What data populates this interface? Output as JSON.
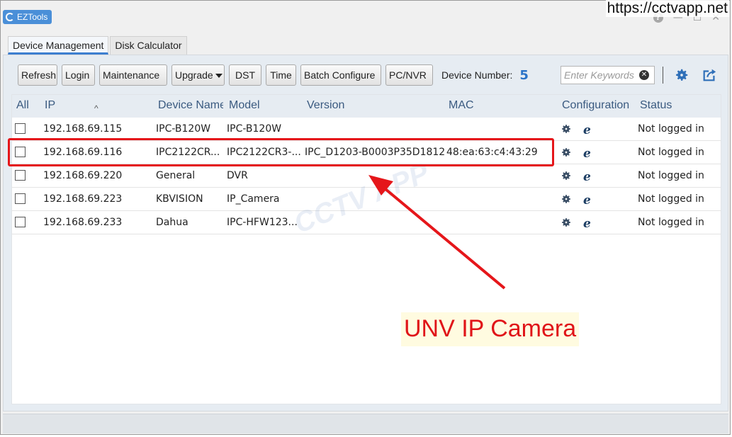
{
  "window": {
    "app_title": "EZTools",
    "help_glyph": "?",
    "minimize_glyph": "—",
    "maximize_glyph": "☐",
    "close_glyph": "✕"
  },
  "watermark_url": "https://cctvapp.net",
  "watermark_logo": "CCTV APP",
  "tabs": [
    "Device Management",
    "Disk Calculator"
  ],
  "active_tab": "Device Management",
  "toolbar": {
    "refresh": "Refresh",
    "login": "Login",
    "maintenance": "Maintenance",
    "upgrade": "Upgrade",
    "dst": "DST",
    "time": "Time",
    "batch_configure": "Batch Configure",
    "pc_nvr": "PC/NVR",
    "device_number_label": "Device Number:",
    "device_number_value": "5",
    "search_placeholder": "Enter Keywords"
  },
  "columns": {
    "all": "All",
    "ip": "IP",
    "device_name": "Device Name",
    "model": "Model",
    "version": "Version",
    "mac": "MAC",
    "configuration": "Configuration",
    "status": "Status"
  },
  "rows": [
    {
      "ip": "192.168.69.115",
      "device_name": "IPC-B120W",
      "model": "IPC-B120W",
      "version": "",
      "mac": "",
      "status": "Not logged in"
    },
    {
      "ip": "192.168.69.116",
      "device_name": "IPC2122CR...",
      "model": "IPC2122CR3-...",
      "version": "IPC_D1203-B0003P35D1812",
      "mac": "48:ea:63:c4:43:29",
      "status": "Not logged in"
    },
    {
      "ip": "192.168.69.220",
      "device_name": "General",
      "model": "DVR",
      "version": "",
      "mac": "",
      "status": "Not logged in"
    },
    {
      "ip": "192.168.69.223",
      "device_name": "KBVISION",
      "model": "IP_Camera",
      "version": "",
      "mac": "",
      "status": "Not logged in"
    },
    {
      "ip": "192.168.69.233",
      "device_name": "Dahua",
      "model": "IPC-HFW123...",
      "version": "",
      "mac": "",
      "status": "Not logged in"
    }
  ],
  "annotation": {
    "label": "UNV IP Camera",
    "color": "#e5161a"
  },
  "colors": {
    "accent": "#3d7fd0",
    "device_number": "#2a73c8",
    "header_text": "#3a5a80"
  }
}
